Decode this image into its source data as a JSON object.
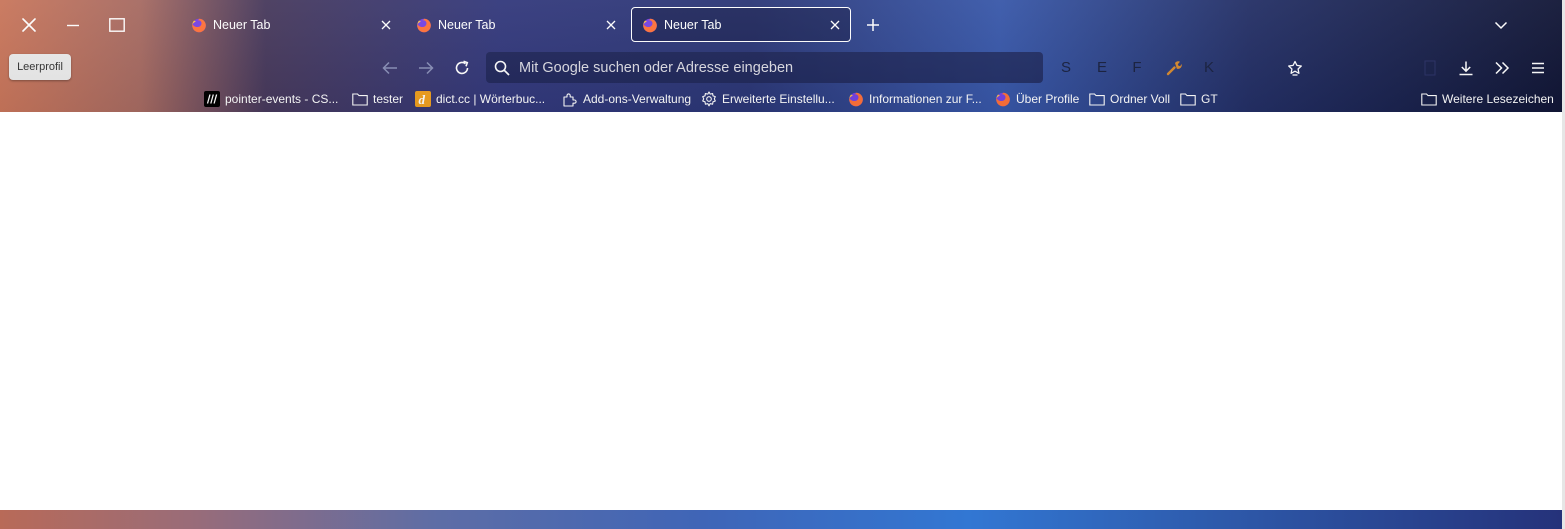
{
  "window": {
    "close_icon": "close-icon",
    "minimize_icon": "minimize-icon",
    "maximize_icon": "maximize-icon"
  },
  "tabs": [
    {
      "label": "Neuer Tab",
      "icon": "firefox-icon",
      "active": false
    },
    {
      "label": "Neuer Tab",
      "icon": "firefox-icon",
      "active": false
    },
    {
      "label": "Neuer Tab",
      "icon": "firefox-icon",
      "active": true
    }
  ],
  "toolbar": {
    "profile_label": "Leerprofil",
    "back_icon": "back-arrow-icon",
    "forward_icon": "forward-arrow-icon",
    "reload_icon": "reload-icon",
    "urlbar_placeholder": "Mit Google suchen oder Adresse eingeben",
    "extensions": [
      "S",
      "E",
      "F",
      "K"
    ],
    "extension_wrench_icon": "wrench-icon",
    "bookmark_star_icon": "bookmark-star-icon",
    "downloads_icon": "download-icon",
    "overflow_icon": "chevron-double-right-icon",
    "menu_icon": "hamburger-menu-icon"
  },
  "bookmarks": [
    {
      "label": "pointer-events - CS...",
      "icon": "mdn-icon"
    },
    {
      "label": "tester",
      "icon": "folder-icon"
    },
    {
      "label": "dict.cc | Wörterbuc...",
      "icon": "dictcc-icon"
    },
    {
      "label": "Add-ons-Verwaltung",
      "icon": "puzzle-icon"
    },
    {
      "label": "Erweiterte Einstellu...",
      "icon": "gear-icon"
    },
    {
      "label": "Informationen zur F...",
      "icon": "firefox-icon"
    },
    {
      "label": "Über Profile",
      "icon": "firefox-icon"
    },
    {
      "label": "Ordner Voll",
      "icon": "folder-icon"
    },
    {
      "label": "GT",
      "icon": "folder-icon"
    }
  ],
  "other_bookmarks": {
    "label": "Weitere Lesezeichen",
    "icon": "folder-icon"
  },
  "colors": {
    "accent_active_tab_border": "#ffffff",
    "urlbar_bg": "#1c2250",
    "wrench_color": "#d88a2e",
    "content_bg": "#ffffff"
  }
}
